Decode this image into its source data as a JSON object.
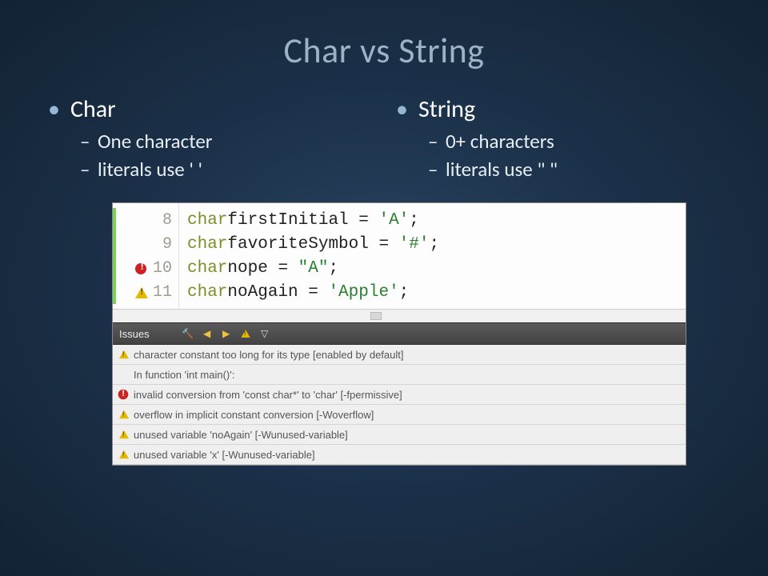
{
  "title": "Char vs String",
  "left": {
    "heading": "Char",
    "sub1": "One character",
    "sub2": "literals use ' '"
  },
  "right": {
    "heading": "String",
    "sub1": "0+ characters",
    "sub2": "literals use \" \""
  },
  "code": {
    "lines": [
      {
        "num": "8",
        "mark": "none",
        "kw": "char",
        "id": "firstInitial",
        "val": "'A'"
      },
      {
        "num": "9",
        "mark": "none",
        "kw": "char",
        "id": "favoriteSymbol",
        "val": "'#'"
      },
      {
        "num": "10",
        "mark": "error",
        "kw": "char",
        "id": "nope",
        "val": "\"A\""
      },
      {
        "num": "11",
        "mark": "warn",
        "kw": "char",
        "id": "noAgain",
        "val": "'Apple'"
      }
    ]
  },
  "issues": {
    "tab": "Issues",
    "rows": [
      {
        "type": "warn",
        "text": "character constant too long for its type [enabled by default]"
      },
      {
        "type": "none",
        "text": "In function 'int main()':"
      },
      {
        "type": "error",
        "text": "invalid conversion from 'const char*' to 'char' [-fpermissive]"
      },
      {
        "type": "warn",
        "text": "overflow in implicit constant conversion [-Woverflow]"
      },
      {
        "type": "warn",
        "text": "unused variable 'noAgain' [-Wunused-variable]"
      },
      {
        "type": "warn",
        "text": "unused variable 'x' [-Wunused-variable]"
      }
    ]
  }
}
